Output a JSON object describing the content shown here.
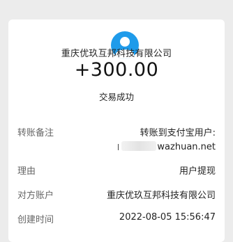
{
  "transaction": {
    "company": "重庆优玖互邦科技有限公司",
    "amount": "+300.00",
    "status": "交易成功"
  },
  "details": {
    "remark_label": "转账备注",
    "remark_line1": "转账到支付宝用户:",
    "remark_line2": "wazhuan.net",
    "reason_label": "理由",
    "reason_value": "用户提现",
    "counterparty_label": "对方账户",
    "counterparty_value": "重庆优玖互邦科技有限公司",
    "created_label": "创建时间",
    "created_value": "2022-08-05 15:56:47"
  },
  "colors": {
    "background": "#ececec",
    "card": "#ffffff",
    "avatar": "#1f9bea"
  },
  "icons": {
    "avatar": "user-avatar-icon"
  }
}
